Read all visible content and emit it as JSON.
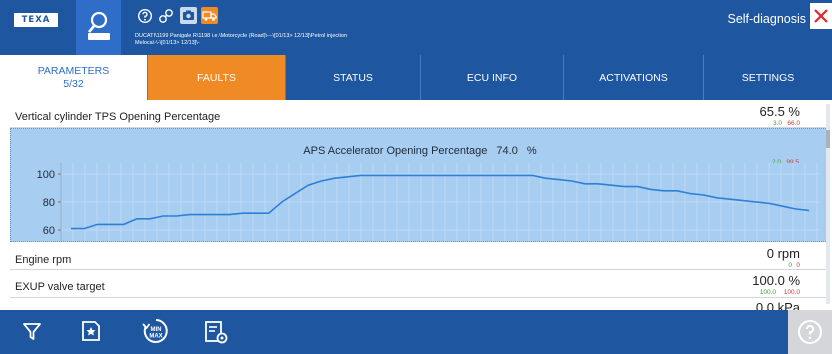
{
  "header": {
    "brand": "TEXA",
    "vehicle_path_line1": "DUCATI\\1199 Panigale R\\1198 i.e.\\Motorcycle (Road)\\---\\[01/13> 12/13]\\Petrol injection",
    "vehicle_path_line2": "Meloca\\-\\-\\[01/13> 12/13]\\-",
    "section_title": "Self-diagnosis",
    "icons": [
      "help-circle-icon",
      "link-icon",
      "camera-icon",
      "truck-icon"
    ]
  },
  "tabs": {
    "parameters_label": "PARAMETERS",
    "parameters_count": "5/32",
    "faults": "FAULTS",
    "status": "STATUS",
    "ecu_info": "ECU INFO",
    "activations": "ACTIVATIONS",
    "settings": "SETTINGS"
  },
  "parameters": [
    {
      "label": "Vertical cylinder TPS Opening Percentage",
      "value": "65.5 %",
      "min": "3.0",
      "max": "66.0"
    },
    {
      "label": "Engine rpm",
      "value": "0 rpm",
      "min": "0",
      "max": "0"
    },
    {
      "label": "EXUP valve target",
      "value": "100.0 %",
      "min": "100.0",
      "max": "100.0"
    },
    {
      "label": "",
      "value": "0.0 kPa"
    }
  ],
  "graph": {
    "title": "APS Accelerator Opening Percentage",
    "value": "74.0",
    "unit": "%",
    "min": "2.0",
    "max": "99.5",
    "y_ticks": [
      "100",
      "80",
      "60"
    ]
  },
  "chart_data": {
    "type": "line",
    "series": [
      {
        "values": [
          61,
          61,
          64,
          64,
          64,
          68,
          68,
          70,
          70,
          71,
          71,
          71,
          71,
          72,
          72,
          72,
          80,
          86,
          92,
          95,
          97,
          98,
          99,
          99,
          99,
          99,
          99,
          99,
          99,
          99,
          99,
          99,
          99,
          99,
          99,
          99,
          97,
          96,
          95,
          93,
          93,
          92,
          91,
          91,
          89,
          88,
          88,
          86,
          85,
          83,
          82,
          81,
          80,
          79,
          77,
          75,
          74
        ]
      }
    ],
    "ylim": [
      55,
      105
    ],
    "y_ticks": [
      100,
      80,
      60
    ],
    "grid": true
  },
  "colors": {
    "header_bg": "#1e56a0",
    "active_tab": "#f08a24",
    "graph_bg": "#a7cdf0",
    "line": "#2f7fd8",
    "min_color": "#3aa33a",
    "max_color": "#d23a3a"
  },
  "bottom": {
    "icons": [
      "filter-icon",
      "favorite-star-icon",
      "min-max-icon",
      "parameter-settings-icon",
      "help-icon"
    ],
    "minmax_label_top": "MIN",
    "minmax_label_bottom": "MAX"
  }
}
